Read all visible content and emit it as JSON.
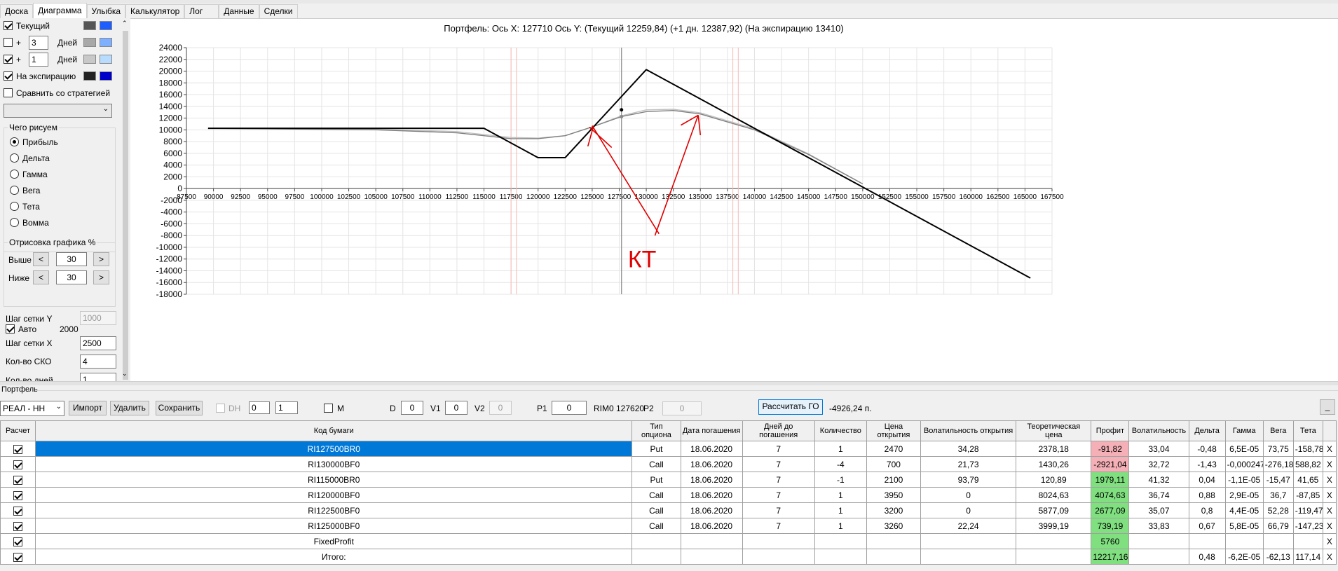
{
  "tabs": [
    "Доска",
    "Диаграмма",
    "Улыбка",
    "Калькулятор",
    "Лог",
    "Данные",
    "Сделки"
  ],
  "active_tab": 1,
  "left": {
    "current_label": "Текущий",
    "plus": "+",
    "days1": "3",
    "days2": "1",
    "days_label": "Дней",
    "expiry_label": "На экспирацию",
    "compare_label": "Сравнить со стратегией",
    "compare_select": "",
    "what_title": "Чего рисуем",
    "radios": [
      "Прибыль",
      "Дельта",
      "Гамма",
      "Вега",
      "Тета",
      "Вомма"
    ],
    "selected_radio": 0,
    "draw_title": "Отрисовка графика %",
    "above_label": "Выше",
    "above_val": "30",
    "below_label": "Ниже",
    "below_val": "30",
    "btn_left": "<",
    "btn_right": ">",
    "grid_y_label": "Шаг сетки Y",
    "grid_y_val": "1000",
    "auto_label": "Авто",
    "auto_val": "2000",
    "grid_x_label": "Шаг сетки X",
    "grid_x_val": "2500",
    "sko_label": "Кол-во СКО",
    "sko_val": "4",
    "days_count_label": "Кол-во дней",
    "days_count_val": "1",
    "colors": {
      "cur_dark": "#555555",
      "cur_light": "#1e5eff",
      "d3_dark": "#a8a8a8",
      "d3_light": "#7fb0ff",
      "d1_dark": "#c8c8c8",
      "d1_light": "#b8dcff",
      "exp_dark": "#222222",
      "exp_light": "#0000c8"
    }
  },
  "portfolio": {
    "label": "Портфель",
    "select": "РЕАЛ - НН",
    "import": "Импорт",
    "delete": "Удалить",
    "save": "Сохранить",
    "dh": "DH",
    "dh_v1": "0",
    "dh_v2": "1",
    "m": "M",
    "d_label": "D",
    "d_val": "0",
    "v1_label": "V1",
    "v1_val": "0",
    "v2_label": "V2",
    "v2_val": "0",
    "p1_label": "P1",
    "p1_val": "0",
    "rim": "RIM0 127620",
    "p2_label": "P2",
    "p2_val": "0",
    "calc_btn": "Рассчитать ГО",
    "go_val": "-4926,24 п.",
    "min_btn": "_"
  },
  "chart_data": {
    "type": "line",
    "title": "Портфель: Ось X:  127710 Ось Y:  (Текущий 12259,84)  (+1 дн. 12387,92)  (На экспирацию 13410)",
    "xlim": [
      87500,
      167500
    ],
    "ylim": [
      -18000,
      24000
    ],
    "x_ticks": [
      87500,
      90000,
      92500,
      95000,
      97500,
      100000,
      102500,
      105000,
      107500,
      110000,
      112500,
      115000,
      117500,
      120000,
      122500,
      125000,
      127500,
      130000,
      132500,
      135000,
      137500,
      140000,
      142500,
      145000,
      147500,
      150000,
      152500,
      155000,
      157500,
      160000,
      162500,
      165000,
      167500
    ],
    "y_ticks": [
      -18000,
      -16000,
      -14000,
      -12000,
      -10000,
      -8000,
      -6000,
      -4000,
      -2000,
      0,
      2000,
      4000,
      6000,
      8000,
      10000,
      12000,
      14000,
      16000,
      18000,
      20000,
      22000,
      24000
    ],
    "cursor_x": 127710,
    "vlines_pink": [
      117500,
      118000,
      138000,
      138500
    ],
    "series": [
      {
        "color": "#000000",
        "x": [
          89500,
          115000,
          120000,
          122500,
          130000,
          165500
        ],
        "y": [
          10260,
          10260,
          5260,
          5260,
          20260,
          -15240
        ]
      },
      {
        "color": "#808080",
        "x": [
          89500,
          105000,
          112500,
          115000,
          117500,
          120000,
          122500,
          125000,
          127710,
          130000,
          132500,
          135000,
          140000,
          145000,
          150000
        ],
        "y": [
          10260,
          10000,
          9500,
          9000,
          8500,
          8500,
          9000,
          10500,
          12260,
          13100,
          13300,
          12700,
          10000,
          5800,
          800
        ]
      },
      {
        "color": "#c0c0c0",
        "x": [
          89500,
          105000,
          112500,
          115000,
          117500,
          120000,
          122500,
          125000,
          127710,
          130000,
          132500,
          135000,
          140000,
          145000,
          150000
        ],
        "y": [
          10260,
          10100,
          9700,
          9200,
          8700,
          8600,
          9000,
          10500,
          12388,
          13400,
          13500,
          12900,
          10200,
          5900,
          800
        ]
      }
    ],
    "annotation": "КТ"
  },
  "table": {
    "headers": [
      "Расчет",
      "Код бумаги",
      "Тип опциона",
      "Дата погашения",
      "Дней до погашения",
      "Количество",
      "Цена открытия",
      "Волатильность открытия",
      "Теоретическая цена",
      "Профит",
      "Волатильность",
      "Дельта",
      "Гамма",
      "Вега",
      "Тета",
      ""
    ],
    "rows": [
      [
        "RI127500BR0",
        "Put",
        "18.06.2020",
        "7",
        "1",
        "2470",
        "34,28",
        "2378,18",
        "-91,82",
        "33,04",
        "-0,48",
        "6,5E-05",
        "73,75",
        "-158,78",
        "X"
      ],
      [
        "RI130000BF0",
        "Call",
        "18.06.2020",
        "7",
        "-4",
        "700",
        "21,73",
        "1430,26",
        "-2921,04",
        "32,72",
        "-1,43",
        "-0,000247",
        "-276,18",
        "588,82",
        "X"
      ],
      [
        "RI115000BR0",
        "Put",
        "18.06.2020",
        "7",
        "-1",
        "2100",
        "93,79",
        "120,89",
        "1979,11",
        "41,32",
        "0,04",
        "-1,1E-05",
        "-15,47",
        "41,65",
        "X"
      ],
      [
        "RI120000BF0",
        "Call",
        "18.06.2020",
        "7",
        "1",
        "3950",
        "0",
        "8024,63",
        "4074,63",
        "36,74",
        "0,88",
        "2,9E-05",
        "36,7",
        "-87,85",
        "X"
      ],
      [
        "RI122500BF0",
        "Call",
        "18.06.2020",
        "7",
        "1",
        "3200",
        "0",
        "5877,09",
        "2677,09",
        "35,07",
        "0,8",
        "4,4E-05",
        "52,28",
        "-119,47",
        "X"
      ],
      [
        "RI125000BF0",
        "Call",
        "18.06.2020",
        "7",
        "1",
        "3260",
        "22,24",
        "3999,19",
        "739,19",
        "33,83",
        "0,67",
        "5,8E-05",
        "66,79",
        "-147,23",
        "X"
      ],
      [
        "FixedProfit",
        "",
        "",
        "",
        "",
        "",
        "",
        "",
        "5760",
        "",
        "",
        "",
        "",
        "",
        "X"
      ],
      [
        "Итого:",
        "",
        "",
        "",
        "",
        "",
        "",
        "",
        "12217,16",
        "",
        "0,48",
        "-6,2E-05",
        "-62,13",
        "117,14",
        "X"
      ]
    ],
    "profit_state": [
      "neg",
      "neg",
      "pos",
      "pos",
      "pos",
      "pos",
      "pos",
      "pos"
    ]
  }
}
